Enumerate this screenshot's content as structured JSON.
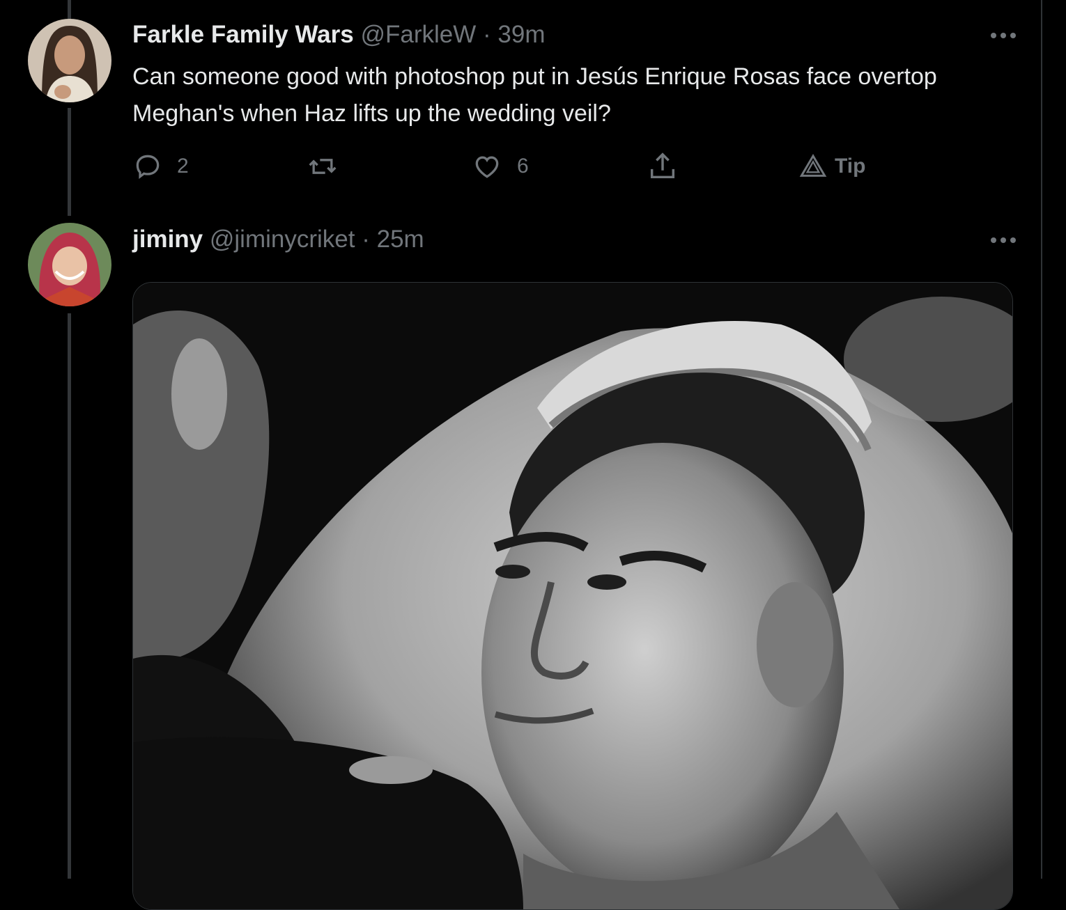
{
  "tweets": [
    {
      "display_name": "Farkle Family Wars",
      "handle": "@FarkleW",
      "separator": "·",
      "time": "39m",
      "text": "Can someone good with photoshop put in Jesús Enrique Rosas face overtop Meghan's when Haz lifts up the wedding veil?",
      "replies": "2",
      "retweets": "",
      "likes": "6",
      "tip_label": "Tip",
      "avatar_icon": "avatar-photo"
    },
    {
      "display_name": "jiminy",
      "handle": "@jiminycriket",
      "separator": "·",
      "time": "25m",
      "avatar_icon": "avatar-photo",
      "media_icon": "photo-black-and-white"
    }
  ],
  "colors": {
    "background": "#000000",
    "text_primary": "#e7e9ea",
    "text_secondary": "#71767b",
    "border": "#2f3336"
  }
}
